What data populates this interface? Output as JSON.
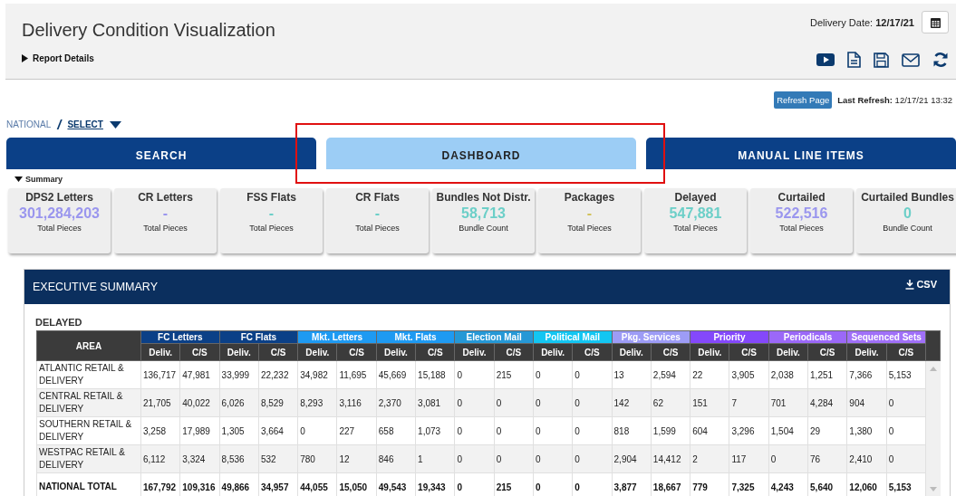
{
  "header": {
    "title": "Delivery Condition Visualization",
    "report_details": "Report Details",
    "delivery_date_label": "Delivery Date:",
    "delivery_date": "12/17/21"
  },
  "refresh": {
    "button": "Refresh Page",
    "label": "Last Refresh:",
    "time": "12/17/21 13:32"
  },
  "breadcrumb": {
    "root": "NATIONAL",
    "separator": "/",
    "select": "SELECT"
  },
  "tabs": [
    {
      "label": "SEARCH",
      "selected": false
    },
    {
      "label": "DASHBOARD",
      "selected": true
    },
    {
      "label": "MANUAL LINE ITEMS",
      "selected": false
    }
  ],
  "summary_label": "Summary",
  "cards": [
    {
      "title": "DPS2 Letters",
      "value": "301,284,203",
      "unit": "Total Pieces",
      "color": "#9a96ee"
    },
    {
      "title": "CR Letters",
      "value": "-",
      "unit": "Total Pieces",
      "color": "#9a96ee"
    },
    {
      "title": "FSS Flats",
      "value": "-",
      "unit": "Total Pieces",
      "color": "#6ccfc8"
    },
    {
      "title": "CR Flats",
      "value": "-",
      "unit": "Total Pieces",
      "color": "#6ccfc8"
    },
    {
      "title": "Bundles Not Distr.",
      "value": "58,713",
      "unit": "Bundle Count",
      "color": "#6ccfc8"
    },
    {
      "title": "Packages",
      "value": "-",
      "unit": "Total Pieces",
      "color": "#d2c25a"
    },
    {
      "title": "Delayed",
      "value": "547,881",
      "unit": "Total Pieces",
      "color": "#6ccfc8"
    },
    {
      "title": "Curtailed",
      "value": "522,516",
      "unit": "Total Pieces",
      "color": "#9a96ee"
    },
    {
      "title": "Curtailed Bundles",
      "value": "0",
      "unit": "Bundle Count",
      "color": "#6ccfc8"
    }
  ],
  "executive_summary": {
    "title": "EXECUTIVE SUMMARY",
    "export": "CSV",
    "section": "DELAYED",
    "table": {
      "area_header": "AREA",
      "groups": [
        {
          "name": "FC Letters",
          "color": "#0b4087",
          "columns": [
            "Deliv.",
            "C/S"
          ]
        },
        {
          "name": "FC Flats",
          "color": "#0b4087",
          "columns": [
            "Deliv.",
            "C/S"
          ]
        },
        {
          "name": "Mkt. Letters",
          "color": "#1e9af2",
          "columns": [
            "Deliv.",
            "C/S"
          ]
        },
        {
          "name": "Mkt. Flats",
          "color": "#1e9af2",
          "columns": [
            "Deliv.",
            "C/S"
          ]
        },
        {
          "name": "Election Mail",
          "color": "#2598d6",
          "columns": [
            "Deliv.",
            "C/S"
          ]
        },
        {
          "name": "Political Mail",
          "color": "#13c6f2",
          "columns": [
            "Deliv.",
            "C/S"
          ]
        },
        {
          "name": "Pkg. Services",
          "color": "#9d9cf6",
          "columns": [
            "Deliv.",
            "C/S"
          ]
        },
        {
          "name": "Priority",
          "color": "#8448fb",
          "columns": [
            "Deliv.",
            "C/S"
          ]
        },
        {
          "name": "Periodicals",
          "color": "#9b68f8",
          "columns": [
            "Deliv.",
            "C/S"
          ]
        },
        {
          "name": "Sequenced Sets",
          "color": "#a070f8",
          "columns": [
            "Deliv.",
            "C/S"
          ]
        }
      ],
      "rows": [
        {
          "kind": "data",
          "area": "ATLANTIC RETAIL & DELIVERY",
          "values": [
            "136,717",
            "47,981",
            "33,999",
            "22,232",
            "34,982",
            "11,695",
            "45,669",
            "15,188",
            "0",
            "215",
            "0",
            "0",
            "13",
            "2,594",
            "22",
            "3,905",
            "2,038",
            "1,251",
            "7,366",
            "5,153"
          ]
        },
        {
          "kind": "data",
          "area": "CENTRAL RETAIL & DELIVERY",
          "values": [
            "21,705",
            "40,022",
            "6,026",
            "8,529",
            "8,293",
            "3,116",
            "2,370",
            "3,081",
            "0",
            "0",
            "0",
            "0",
            "142",
            "62",
            "151",
            "7",
            "701",
            "4,284",
            "904",
            "0"
          ]
        },
        {
          "kind": "data",
          "area": "SOUTHERN RETAIL & DELIVERY",
          "values": [
            "3,258",
            "17,989",
            "1,305",
            "3,664",
            "0",
            "227",
            "658",
            "1,073",
            "0",
            "0",
            "0",
            "0",
            "818",
            "1,599",
            "604",
            "3,296",
            "1,504",
            "29",
            "1,380",
            "0"
          ]
        },
        {
          "kind": "data",
          "area": "WESTPAC RETAIL & DELIVERY",
          "values": [
            "6,112",
            "3,324",
            "8,536",
            "532",
            "780",
            "12",
            "846",
            "1",
            "0",
            "0",
            "0",
            "0",
            "2,904",
            "14,412",
            "2",
            "117",
            "0",
            "76",
            "2,410",
            "0"
          ]
        },
        {
          "kind": "total",
          "area": "NATIONAL TOTAL",
          "values": [
            "167,792",
            "109,316",
            "49,866",
            "34,957",
            "44,055",
            "15,050",
            "49,543",
            "19,343",
            "0",
            "215",
            "0",
            "0",
            "3,877",
            "18,667",
            "779",
            "7,325",
            "4,243",
            "5,640",
            "12,060",
            "5,153"
          ]
        }
      ]
    }
  }
}
